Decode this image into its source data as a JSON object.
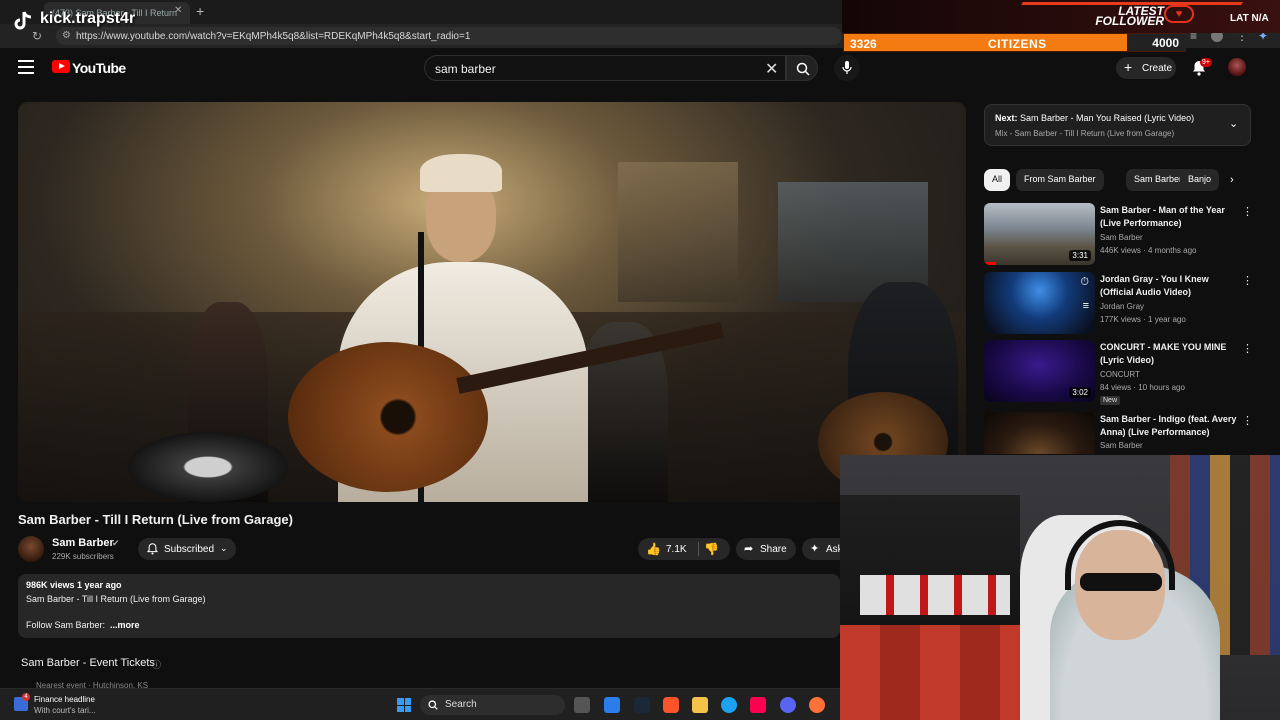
{
  "browser": {
    "tab_title": "(473) Sam Barber - Till I Return",
    "url": "https://www.youtube.com/watch?v=EKqMPh4k5q8&list=RDEKqMPh4k5q8&start_radio=1"
  },
  "overlay": {
    "streamer_handle": "kick.trapst4r",
    "follower_banner_title": "LATEST FOLLOWER",
    "follower_name": "LAT N/A",
    "citizens_left": "3326",
    "citizens_label": "CITIZENS",
    "citizens_right": "4000"
  },
  "header": {
    "logo_text": "YouTube",
    "search_value": "sam barber",
    "create_label": "Create",
    "notifications_badge": "9+"
  },
  "video": {
    "title": "Sam Barber - Till I Return (Live from Garage)",
    "channel_name": "Sam Barber",
    "subscribers": "229K subscribers",
    "subscribe_label": "Subscribed",
    "likes": "7.1K",
    "share_label": "Share",
    "ask_label": "Ask"
  },
  "description": {
    "meta": "986K views  1 year ago",
    "line1": "Sam Barber - Till I Return  (Live from Garage)",
    "follow": "Follow Sam Barber:",
    "more": "...more"
  },
  "tickets": {
    "title": "Sam Barber - Event Tickets",
    "sub": "Nearest event · Hutchinson, KS"
  },
  "up_next": {
    "label": "Next:",
    "title": "Sam Barber - Man You Raised (Lyric Video)",
    "sub": "Mix - Sam Barber - Till I Return (Live from Garage)"
  },
  "chips": [
    "All",
    "From Sam Barber",
    "Sam Barber",
    "Banjo"
  ],
  "recommendations": [
    {
      "title": "Sam Barber - Man of the Year (Live Performance)",
      "channel": "Sam Barber",
      "meta": "446K views · 4 months ago",
      "duration": "3:31",
      "new": ""
    },
    {
      "title": "Jordan Gray - You I Knew (Official Audio Video)",
      "channel": "Jordan Gray",
      "meta": "177K views · 1 year ago",
      "duration": "",
      "new": ""
    },
    {
      "title": "CONCURT - MAKE YOU MINE (Lyric Video)",
      "channel": "CONCURT",
      "meta": "84 views · 10 hours ago",
      "duration": "3:02",
      "new": "New"
    },
    {
      "title": "Sam Barber - Indigo (feat. Avery Anna) (Live Performance)",
      "channel": "Sam Barber",
      "meta": "",
      "duration": "",
      "new": ""
    }
  ],
  "taskbar": {
    "news_badge": "4",
    "news_title": "Finance headline",
    "news_sub": "With court's tari...",
    "search_label": "Search"
  },
  "colors": {
    "brand_red": "#ff0000",
    "accent_orange": "#f37b12",
    "background": "#0f0f0f"
  }
}
